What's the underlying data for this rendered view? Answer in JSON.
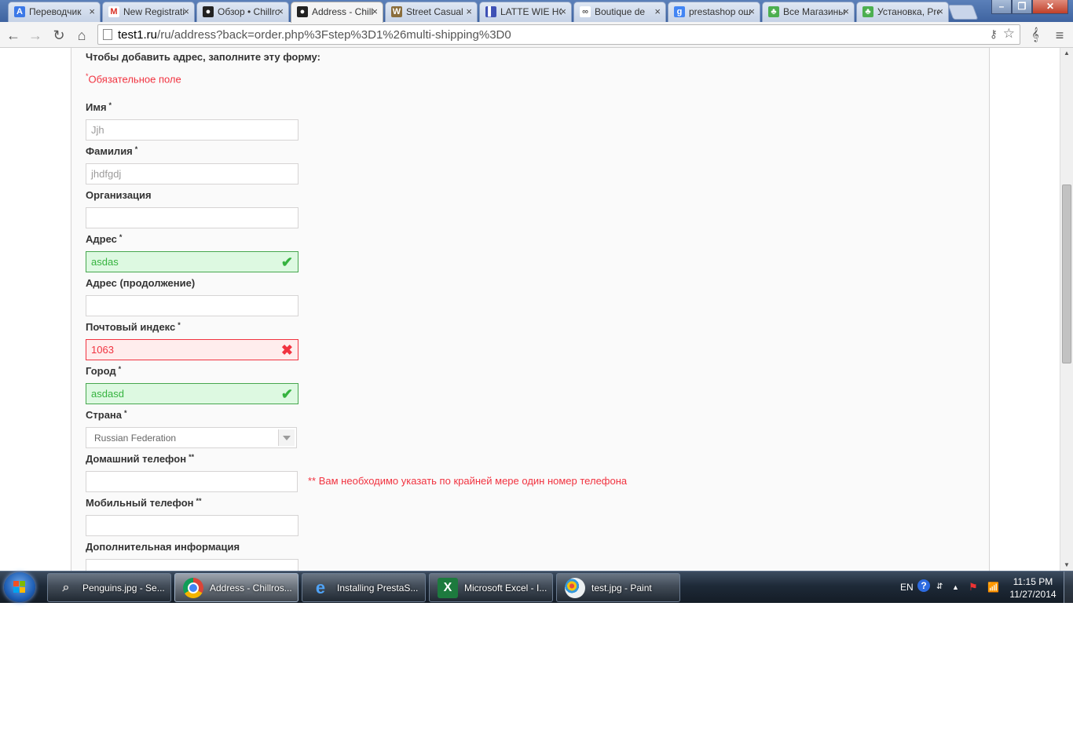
{
  "browser": {
    "tabs": [
      {
        "label": "Переводчик",
        "icon_color": "#3b78e7",
        "icon": "translate-icon",
        "glyph": "A"
      },
      {
        "label": "New Registration",
        "icon_color": "#d93025",
        "icon": "gmail-icon",
        "glyph": "M"
      },
      {
        "label": "Обзор • Chillros",
        "icon_color": "#222222",
        "icon": "prestashop-icon",
        "glyph": "●"
      },
      {
        "label": "Address - Chillros",
        "icon_color": "#222222",
        "icon": "prestashop-icon",
        "glyph": "●"
      },
      {
        "label": "Street Casual",
        "icon_color": "#8a6d3b",
        "icon": "store-icon",
        "glyph": "W"
      },
      {
        "label": "LATTE WIE HOF",
        "icon_color": "#3f51b5",
        "icon": "barcode-icon",
        "glyph": "▌"
      },
      {
        "label": "Boutique de",
        "icon_color": "#555555",
        "icon": "link-icon",
        "glyph": "∞"
      },
      {
        "label": "prestashop ошибка",
        "icon_color": "#4285f4",
        "icon": "google-icon",
        "glyph": "g"
      },
      {
        "label": "Все Магазины",
        "icon_color": "#4caf50",
        "icon": "leaf-icon",
        "glyph": "♣"
      },
      {
        "label": "Установка, PrestaShop",
        "icon_color": "#4caf50",
        "icon": "leaf-icon",
        "glyph": "♣"
      }
    ],
    "active_tab_index": 3,
    "url_host": "test1.ru",
    "url_path": "/ru/address?back=order.php%3Fstep%3D1%26multi-shipping%3D0"
  },
  "form": {
    "intro": "Чтобы добавить адрес, заполните эту форму:",
    "required_note": "Обязательное поле",
    "required_mark": "*",
    "fields": {
      "firstname": {
        "label": "Имя",
        "value": "Jjh"
      },
      "lastname": {
        "label": "Фамилия",
        "value": "jhdfgdj"
      },
      "company": {
        "label": "Организация",
        "value": ""
      },
      "address1": {
        "label": "Адрес",
        "value": "asdas"
      },
      "address2": {
        "label": "Адрес (продолжение)",
        "value": ""
      },
      "postcode": {
        "label": "Почтовый индекс",
        "value": "1063"
      },
      "city": {
        "label": "Город",
        "value": "asdasd"
      },
      "country": {
        "label": "Страна",
        "value": "Russian Federation"
      },
      "phone": {
        "label": "Домашний телефон",
        "value": ""
      },
      "phone_mobile": {
        "label": "Мобильный телефон",
        "value": ""
      },
      "other": {
        "label": "Дополнительная информация",
        "value": ""
      }
    },
    "phone_mark": "**",
    "phone_note": "** Вам необходимо указать по крайней мере один номер телефона",
    "valid_color": "#35b33f",
    "error_color": "#f13340"
  },
  "taskbar": {
    "buttons": [
      {
        "label": "Penguins.jpg - Se...",
        "icon": "magnifier-icon"
      },
      {
        "label": "Address - Chillros...",
        "icon": "chrome-icon"
      },
      {
        "label": "Installing PrestaS...",
        "icon": "ie-icon"
      },
      {
        "label": "Microsoft Excel - I...",
        "icon": "excel-icon"
      },
      {
        "label": "test.jpg - Paint",
        "icon": "paint-icon"
      }
    ],
    "language": "EN",
    "time": "11:15 PM",
    "date": "11/27/2014"
  }
}
